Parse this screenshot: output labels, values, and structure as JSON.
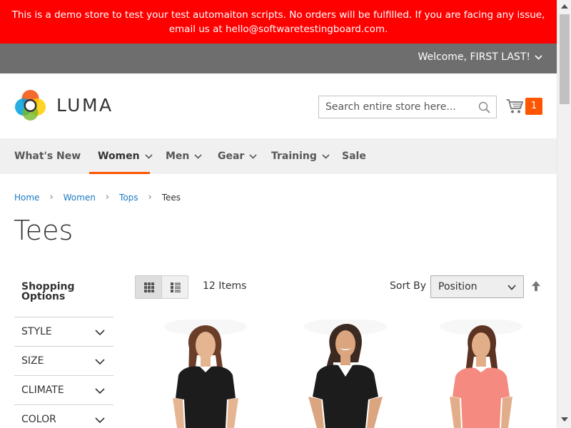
{
  "banner": {
    "text": "This is a demo store to test your test automaiton scripts. No orders will be fulfilled. If you are facing any issue, email us at hello@softwaretestingboard.com."
  },
  "header": {
    "welcome": "Welcome, FIRST LAST!",
    "logo_text": "LUMA",
    "search_placeholder": "Search entire store here...",
    "cart_count": "1"
  },
  "nav": {
    "items": [
      {
        "label": "What's New",
        "dropdown": false
      },
      {
        "label": "Women",
        "dropdown": true,
        "active": true
      },
      {
        "label": "Men",
        "dropdown": true
      },
      {
        "label": "Gear",
        "dropdown": true
      },
      {
        "label": "Training",
        "dropdown": true
      },
      {
        "label": "Sale",
        "dropdown": false
      }
    ]
  },
  "breadcrumbs": {
    "items": [
      "Home",
      "Women",
      "Tops"
    ],
    "current": "Tees"
  },
  "page_title": "Tees",
  "sidebar": {
    "title": "Shopping Options",
    "filters": [
      "STYLE",
      "SIZE",
      "CLIMATE",
      "COLOR"
    ]
  },
  "toolbar": {
    "items_count": "12 Items",
    "sort_label": "Sort By",
    "sort_value": "Position"
  },
  "products": [
    {
      "shirt_color": "#1c1c1c"
    },
    {
      "shirt_color": "#1c1c1c"
    },
    {
      "shirt_color": "#f48a80"
    }
  ],
  "colors": {
    "banner": "#ff0000",
    "header_bar": "#6e6e6e",
    "accent": "#ff5501",
    "link": "#1979c3"
  }
}
